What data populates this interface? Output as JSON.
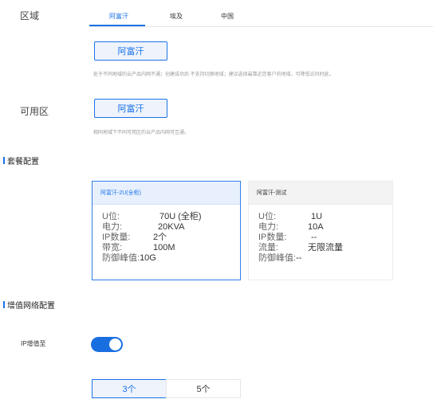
{
  "region": {
    "label": "区域",
    "tabs": [
      {
        "label": "阿富汗",
        "active": true
      },
      {
        "label": "埃及",
        "active": false
      },
      {
        "label": "中国",
        "active": false
      }
    ],
    "selected": "阿富汗",
    "note": "处于不同地域的云产品内网不通；创建成功后 不支持切换地域；建议选择最靠近您客户的地域，可降低访问时延。"
  },
  "zone": {
    "label": "可用区",
    "selected": "阿富汗",
    "note": "相同地域下不同可用区的云产品内网可互通。"
  },
  "package": {
    "title": "套餐配置",
    "cards": [
      {
        "name": "阿富汗-2U(全柜)",
        "selected": true,
        "specs": [
          {
            "k": "U位:",
            "v": "70U (全柜)"
          },
          {
            "k": "电力:",
            "v": "20KVA"
          },
          {
            "k": "IP数量:",
            "v": "2个"
          },
          {
            "k": "带宽:",
            "v": "100M"
          },
          {
            "k": "防御峰值:",
            "v": "10G"
          }
        ]
      },
      {
        "name": "阿富汗-测试",
        "selected": false,
        "specs": [
          {
            "k": "U位:",
            "v": "1U"
          },
          {
            "k": "电力:",
            "v": "10A"
          },
          {
            "k": "IP数量:",
            "v": "--"
          },
          {
            "k": "流量:",
            "v": "无限流量"
          },
          {
            "k": "防御峰值:",
            "v": "--"
          }
        ]
      }
    ]
  },
  "network": {
    "title": "增值网络配置",
    "ip_label": "IP增值至",
    "toggle_on": true,
    "options": [
      {
        "label": "3个",
        "active": true
      },
      {
        "label": "5个",
        "active": false
      }
    ]
  },
  "colors": {
    "accent": "#1a73e8",
    "toggle": "#1a6fe0"
  }
}
